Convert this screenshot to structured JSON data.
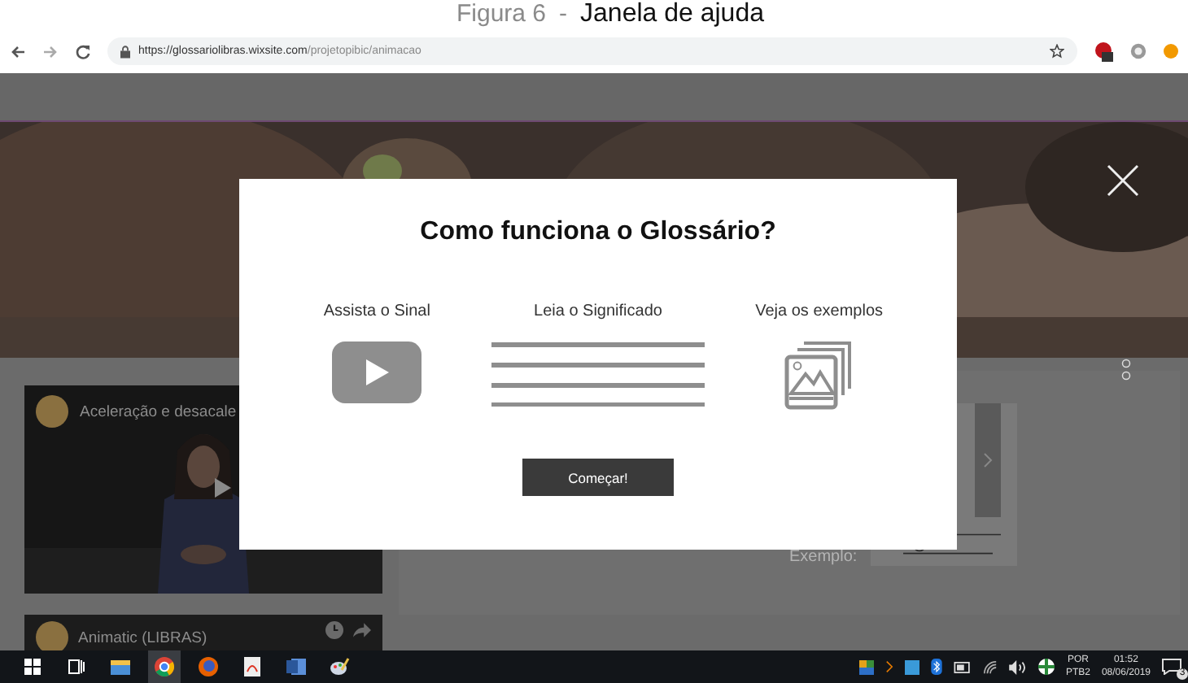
{
  "caption": {
    "number": "Figura 6",
    "separator": "-",
    "title": "Janela de ajuda"
  },
  "browser": {
    "url_host": "https://glossariolibras.wixsite.com",
    "url_path": "/projetopibic/animacao"
  },
  "page": {
    "cards": [
      {
        "title": "Aceleração e desacale",
        "kind": "video"
      },
      {
        "title": "Animatic (LIBRAS)",
        "kind": "row"
      }
    ],
    "example_label": "Exemplo:"
  },
  "modal": {
    "title": "Como funciona o Glossário?",
    "steps": [
      {
        "label": "Assista o Sinal",
        "kind": "video"
      },
      {
        "label": "Leia o Significado",
        "kind": "text"
      },
      {
        "label": "Veja os exemplos",
        "kind": "gallery"
      }
    ],
    "button": "Começar!"
  },
  "taskbar": {
    "apps": [
      {
        "kind": "start",
        "selected": false
      },
      {
        "kind": "taskview",
        "selected": false
      },
      {
        "kind": "explorer",
        "selected": false
      },
      {
        "kind": "chrome",
        "selected": true
      },
      {
        "kind": "firefox",
        "selected": false
      },
      {
        "kind": "pdf",
        "selected": false
      },
      {
        "kind": "word",
        "selected": false
      },
      {
        "kind": "paint",
        "selected": false
      }
    ],
    "language": "POR",
    "layout": "PTB2",
    "time": "01:52",
    "date": "08/06/2019",
    "notifications": "3"
  }
}
